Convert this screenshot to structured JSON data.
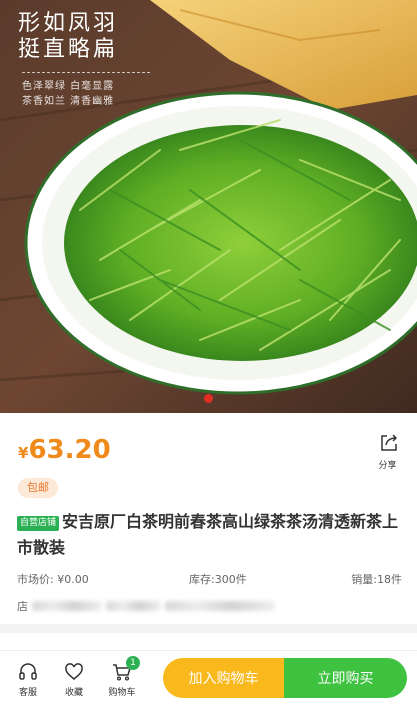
{
  "hero": {
    "headline_line1": "形如凤羽",
    "headline_line2": "挺直略扁",
    "subline_1": "色泽翠绿 白毫显露",
    "subline_2": "茶香如兰 清香幽雅",
    "slide_count": 1,
    "active_slide": 1
  },
  "product": {
    "currency": "¥",
    "price": "63.20",
    "share_label": "分享",
    "badge": "包邮",
    "store_tag": "自营店铺",
    "title": "安吉原厂白茶明前春茶高山绿茶茶汤清透新茶上市散装",
    "market_price": "市场价: ¥0.00",
    "stock": "库存:300件",
    "sales": "销量:18件",
    "shop_label": "店"
  },
  "bottom_bar": {
    "service": "客服",
    "favorite": "收藏",
    "cart": "购物车",
    "cart_count": "1",
    "add_to_cart": "加入购物车",
    "buy_now": "立即购买"
  },
  "colors": {
    "price": "#f08a1b",
    "add_to_cart": "#f9b81b",
    "buy_now": "#3fc23f",
    "store_tag": "#2bb153",
    "active_dot": "#e02e24"
  }
}
